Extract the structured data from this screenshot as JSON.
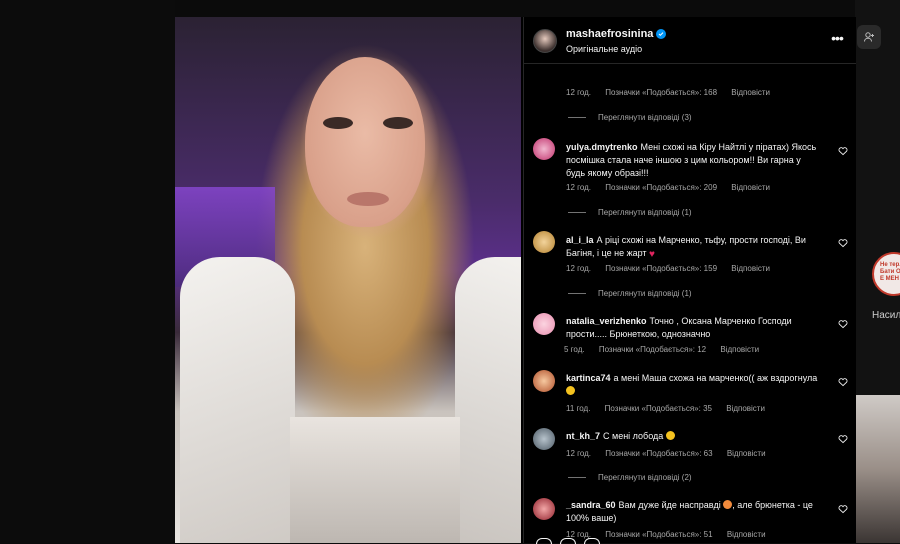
{
  "post": {
    "username": "mashaefrosinina",
    "audio": "Оригінальне аудіо"
  },
  "side": {
    "caption": "Насиль",
    "badge_text": "Не тер. Бати Обир Е МЕН"
  },
  "labels": {
    "reply": "Відповісти"
  },
  "comments": [
    {
      "time": "12 год.",
      "likes": "Позначки «Подобається»: 168",
      "view_replies": "Переглянути відповіді (3)"
    },
    {
      "username": "yulya.dmytrenko",
      "text": "Мені схожі на Кіру Найтлі у піратах) Якось посмішка стала наче іншою з цим кольором!! Ви гарна у будь якому образі!!!",
      "time": "12 год.",
      "likes": "Позначки «Подобається»: 209",
      "view_replies": "Переглянути відповіді (1)"
    },
    {
      "username": "al_i_la",
      "text": "А ріці схожі на Марченко, тьфу, прости господі, Ви Багіня, і це не жарт",
      "time": "12 год.",
      "likes": "Позначки «Подобається»: 159",
      "view_replies": "Переглянути відповіді (1)"
    },
    {
      "username": "natalia_verizhenko",
      "text": "Точно , Оксана Марченко Господи прости..... Брюнеткою, однозначно",
      "time": "5 год.",
      "likes": "Позначки «Подобається»: 12"
    },
    {
      "username": "kartinca74",
      "text": "а мені Маша схожа на марченко(( аж вздрогнула",
      "time": "11 год.",
      "likes": "Позначки «Подобається»: 35"
    },
    {
      "username": "nt_kh_7",
      "text": "С мені лобода",
      "time": "12 год.",
      "likes": "Позначки «Подобається»: 63",
      "view_replies": "Переглянути відповіді (2)"
    },
    {
      "username": "_sandra_60",
      "text": "Вам дуже йде насправді",
      "text2": ", але брюнетка - це 100% ваше)",
      "time": "12 год.",
      "likes": "Позначки «Подобається»: 51"
    }
  ]
}
